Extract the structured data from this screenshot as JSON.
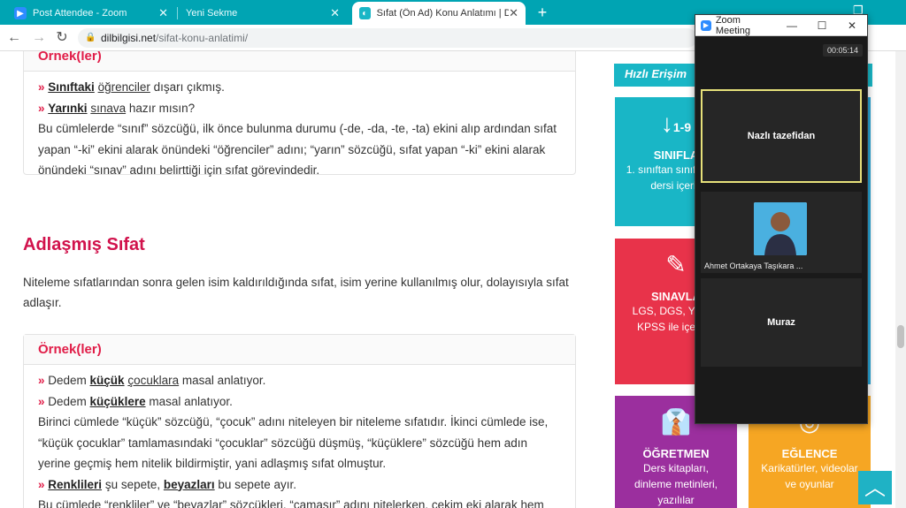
{
  "tabs": [
    {
      "title": "Post Attendee - Zoom"
    },
    {
      "title": "Yeni Sekme"
    },
    {
      "title": "Sıfat (Ön Ad) Konu Anlatımı | Dil..."
    }
  ],
  "address": {
    "host": "dilbilgisi.net",
    "path": "/sifat-konu-anlatimi/"
  },
  "card1": {
    "head": "Örnek(ler)",
    "l1_mark": "»",
    "l1_a": "Sınıftaki",
    "l1_b": "öğrenciler",
    "l1_c": " dışarı çıkmış.",
    "l2_mark": "»",
    "l2_a": "Yarınki",
    "l2_b": "sınava",
    "l2_c": " hazır mısın?",
    "text": "Bu cümlelerde “sınıf” sözcüğü, ilk önce bulunma durumu (-de, -da, -te, -ta) ekini alıp ardından sıfat yapan “-ki” ekini alarak önündeki “öğrenciler” adını; “yarın” sözcüğü, sıfat yapan “-ki” ekini alarak önündeki “sınav” adını belirttiği için sıfat görevindedir."
  },
  "heading": "Adlaşmış Sıfat",
  "paragraph": "Niteleme sıfatlarından sonra gelen isim kaldırıldığında sıfat, isim yerine kullanılmış olur, dolayısıyla sıfat adlaşır.",
  "card2": {
    "head": "Örnek(ler)",
    "l1_mark": "»",
    "l1_a": " Dedem ",
    "l1_b": "küçük",
    "l1_c": "çocuklara",
    "l1_d": " masal anlatıyor.",
    "l2_mark": "»",
    "l2_a": " Dedem ",
    "l2_b": "küçüklere",
    "l2_c": " masal anlatıyor.",
    "text1": "Birinci cümlede “küçük” sözcüğü, “çocuk” adını niteleyen bir niteleme sıfatıdır. İkinci cümlede ise, “küçük çocuklar” tamlamasındaki “çocuklar” sözcüğü düşmüş, “küçüklere” sözcüğü hem adın yerine geçmiş hem nitelik bildirmiştir, yani adlaşmış sıfat olmuştur.",
    "l3_mark": "»",
    "l3_a": "Renklileri",
    "l3_b": " şu sepete, ",
    "l3_c": "beyazları",
    "l3_d": " bu sepete ayır.",
    "text2": "Bu cümlede “renkliler” ve “beyazlar” sözcükleri, “çamaşır” adını nitelerken, çekim eki alarak hem"
  },
  "quick_access": "Hızlı Erişim",
  "tiles": [
    {
      "icon": "1-9",
      "title": "SINIFLA",
      "desc": "1. sınıftan sınıfa Türk dersi içerik"
    },
    {
      "icon": "✎",
      "title": "SINAVLA",
      "desc": "LGS, DGS, Y TYT, KPSS ile içerikle"
    },
    {
      "icon": "👔",
      "title": "ÖĞRETMEN",
      "desc": "Ders kitapları, dinleme metinleri, yazılılar"
    },
    {
      "icon": "◎",
      "title": "EĞLENCE",
      "desc": "Karikatürler, videolar ve oyunlar"
    }
  ],
  "zoom": {
    "title": "Zoom Meeting",
    "timer": "00:05:14",
    "p1": "Nazlı tazefidan",
    "p2_name": "Ahmet Ortakaya Taşıkara ...",
    "p3": "Muraz"
  },
  "colors": {
    "accent": "#00a4b3",
    "heading": "#d1124c",
    "tile1": "#19b6c6",
    "tile2": "#e8334a",
    "tile3": "#9b2f9e",
    "tile4": "#f6a623",
    "zoom_active": "#e6e07a"
  }
}
